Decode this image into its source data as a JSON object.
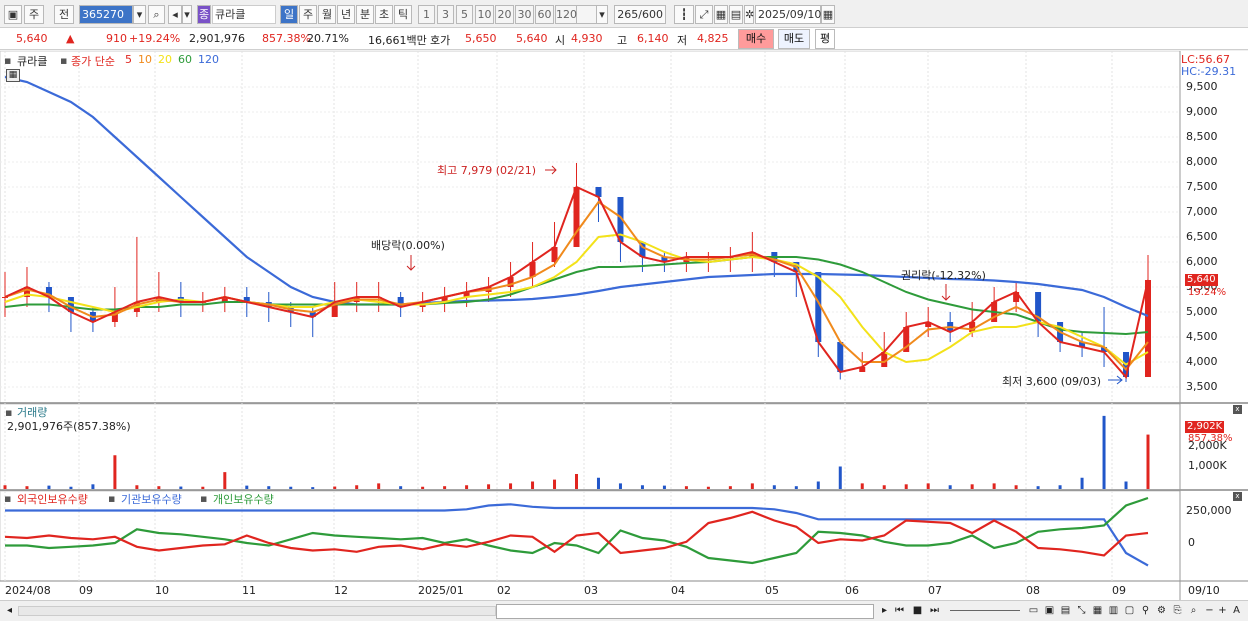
{
  "toolbar": {
    "market": "주",
    "prev_label": "전",
    "code": "365270",
    "name_badge": "종",
    "name": "큐라클",
    "periods": [
      "일",
      "주",
      "월",
      "년",
      "분",
      "초",
      "틱"
    ],
    "active_period": "일",
    "intervals": [
      "1",
      "3",
      "5",
      "10",
      "20",
      "30",
      "60",
      "120"
    ],
    "count": "265",
    "count_total": "/600",
    "date": "2025/09/10"
  },
  "quote": {
    "price": "5,640",
    "direction": "▲",
    "change": "910",
    "change_pct": "+19.24%",
    "volume": "2,901,976",
    "volume_ratio": "857.38%",
    "turnover": "20.71%",
    "amount": "16,661백만",
    "bid_label": "호가",
    "bid1": "5,650",
    "bid2": "5,640",
    "open_label": "시",
    "open": "4,930",
    "high_label": "고",
    "high": "6,140",
    "low_label": "저",
    "low": "4,825",
    "buy_label": "매수",
    "sell_label": "매도",
    "eval_label": "평"
  },
  "price_pane": {
    "name": "큐라클",
    "ma_type": "종가 단순",
    "ma_periods": [
      {
        "p": "5",
        "color": "#e0251f"
      },
      {
        "p": "10",
        "color": "#f08a1c"
      },
      {
        "p": "20",
        "color": "#f3e21a"
      },
      {
        "p": "60",
        "color": "#2e9b3a"
      },
      {
        "p": "120",
        "color": "#3b6ad8"
      }
    ],
    "lc": "LC:56.67",
    "hc": "HC:-29.31",
    "y_ticks": [
      "9,500",
      "9,000",
      "8,500",
      "8,000",
      "7,500",
      "7,000",
      "6,500",
      "6,000",
      "5,500",
      "5,000",
      "4,500",
      "4,000",
      "3,500"
    ],
    "last_price_tag": "5,640",
    "last_pct_tag": "19.24%",
    "ann_high": "최고 7,979 (02/21)",
    "ann_div": "배당락(0.00%)",
    "ann_rights": "권리락(-12.32%)",
    "ann_low": "최저 3,600 (09/03)",
    "series": {
      "price_range": [
        3500,
        9800
      ],
      "ma120": [
        9700,
        9600,
        9400,
        9200,
        8900,
        8500,
        8100,
        7700,
        7300,
        6900,
        6500,
        6100,
        5800,
        5500,
        5300,
        5200,
        5150,
        5150,
        5150,
        5180,
        5200,
        5220,
        5230,
        5240,
        5260,
        5300,
        5350,
        5420,
        5500,
        5550,
        5600,
        5650,
        5700,
        5720,
        5740,
        5760,
        5760,
        5760,
        5750,
        5740,
        5720,
        5700,
        5680,
        5660,
        5650,
        5630,
        5600,
        5560,
        5500,
        5440,
        5300,
        5100,
        4920
      ],
      "ma60": [
        5100,
        5150,
        5150,
        5100,
        5050,
        5050,
        5100,
        5100,
        5150,
        5150,
        5200,
        5200,
        5150,
        5150,
        5150,
        5150,
        5150,
        5150,
        5150,
        5150,
        5180,
        5200,
        5250,
        5350,
        5500,
        5650,
        5800,
        5900,
        5900,
        5920,
        5950,
        5980,
        6000,
        6050,
        6100,
        6100,
        6100,
        6050,
        5950,
        5800,
        5600,
        5400,
        5250,
        5150,
        5050,
        5000,
        4950,
        4800,
        4650,
        4600,
        4580,
        4560,
        4600
      ],
      "ma20": [
        5200,
        5350,
        5300,
        5200,
        5100,
        5000,
        5100,
        5200,
        5250,
        5200,
        5300,
        5200,
        5150,
        5100,
        5100,
        5200,
        5250,
        5200,
        5150,
        5150,
        5200,
        5300,
        5350,
        5400,
        5500,
        5700,
        6000,
        6500,
        6550,
        6400,
        6200,
        6050,
        6000,
        6050,
        6100,
        6050,
        5950,
        5700,
        5300,
        4700,
        4200,
        4000,
        4050,
        4300,
        4600,
        4700,
        4700,
        4800,
        4700,
        4500,
        4300,
        3950,
        4200
      ],
      "ma10": [
        5300,
        5450,
        5350,
        5100,
        4900,
        4950,
        5150,
        5250,
        5200,
        5200,
        5300,
        5200,
        5150,
        5050,
        5000,
        5150,
        5250,
        5250,
        5150,
        5200,
        5300,
        5400,
        5450,
        5550,
        5700,
        5950,
        6600,
        7200,
        6900,
        6300,
        6100,
        6050,
        6050,
        6100,
        6150,
        6050,
        5900,
        5200,
        4400,
        4000,
        4000,
        4300,
        4650,
        4700,
        4650,
        4900,
        5100,
        4900,
        4600,
        4400,
        4300,
        3850,
        4400
      ],
      "close": [
        5300,
        5500,
        5300,
        5000,
        4800,
        5000,
        5200,
        5300,
        5200,
        5200,
        5300,
        5200,
        5100,
        5000,
        4900,
        5200,
        5300,
        5300,
        5100,
        5200,
        5300,
        5400,
        5500,
        5700,
        6000,
        6300,
        7500,
        7300,
        6400,
        6100,
        6000,
        6100,
        6100,
        6100,
        6200,
        6000,
        5800,
        4400,
        3800,
        3900,
        4200,
        4700,
        4800,
        4600,
        4800,
        5200,
        5400,
        4800,
        4400,
        4300,
        4200,
        3700,
        5640
      ],
      "highs": [
        5800,
        5900,
        5600,
        5200,
        5100,
        5500,
        6500,
        5800,
        5600,
        5400,
        5500,
        5500,
        5400,
        5200,
        5100,
        5600,
        5600,
        5600,
        5400,
        5400,
        5500,
        5600,
        5700,
        6000,
        6400,
        6800,
        7979,
        7500,
        6700,
        6300,
        6200,
        6200,
        6200,
        6300,
        6600,
        6200,
        6000,
        4800,
        4100,
        4200,
        4600,
        5000,
        5100,
        5000,
        5200,
        5500,
        5600,
        5300,
        4700,
        4600,
        5100,
        3900,
        6140
      ],
      "lows": [
        4900,
        5100,
        5000,
        4600,
        4600,
        4700,
        4900,
        5000,
        4900,
        5000,
        5000,
        4900,
        4800,
        4700,
        4500,
        4900,
        5000,
        5000,
        4900,
        5000,
        5000,
        5100,
        5200,
        5300,
        5500,
        5900,
        6300,
        6800,
        6000,
        5800,
        5800,
        5800,
        5800,
        5800,
        5800,
        5700,
        5300,
        4100,
        3650,
        3800,
        3900,
        4400,
        4500,
        4400,
        4500,
        4800,
        5000,
        4500,
        4200,
        4100,
        3900,
        3600,
        4825
      ]
    }
  },
  "volume_pane": {
    "title": "거래량",
    "value": "2,901,976주(857.38%)",
    "y_ticks": [
      "2,000K",
      "1,000K"
    ],
    "last_tag": "2,902K",
    "last_pct": "857.38%",
    "volumes_k": [
      200,
      150,
      180,
      120,
      250,
      1800,
      200,
      150,
      130,
      120,
      900,
      180,
      150,
      120,
      100,
      130,
      200,
      300,
      150,
      120,
      150,
      200,
      250,
      300,
      400,
      500,
      800,
      600,
      300,
      200,
      180,
      150,
      120,
      150,
      300,
      200,
      150,
      400,
      1200,
      300,
      200,
      250,
      300,
      200,
      250,
      300,
      200,
      150,
      200,
      600,
      3900,
      400,
      2902
    ],
    "ymax": 4000
  },
  "holdings_pane": {
    "legend": [
      "외국인보유수량",
      "기관보유수량",
      "개인보유수량"
    ],
    "y_ticks": [
      "250,000",
      "0"
    ],
    "foreign": [
      50,
      40,
      60,
      40,
      30,
      50,
      -30,
      -60,
      -40,
      -20,
      -10,
      60,
      0,
      -40,
      -60,
      -50,
      -70,
      -30,
      -20,
      -50,
      -10,
      -30,
      10,
      60,
      50,
      -70,
      60,
      80,
      -80,
      -60,
      -40,
      10,
      160,
      200,
      250,
      180,
      130,
      0,
      30,
      20,
      60,
      180,
      170,
      160,
      80,
      180,
      90,
      -40,
      -50,
      -70,
      -100,
      60,
      80
    ],
    "institution": [
      260,
      260,
      260,
      260,
      260,
      260,
      260,
      260,
      260,
      260,
      260,
      260,
      260,
      260,
      260,
      260,
      260,
      260,
      260,
      260,
      260,
      270,
      300,
      310,
      290,
      280,
      280,
      280,
      280,
      280,
      280,
      280,
      280,
      280,
      280,
      270,
      240,
      190,
      190,
      190,
      190,
      190,
      190,
      190,
      190,
      190,
      190,
      190,
      190,
      190,
      190,
      -80,
      -180
    ],
    "individual": [
      -20,
      -20,
      -40,
      -30,
      -20,
      0,
      110,
      80,
      70,
      50,
      30,
      0,
      -20,
      30,
      80,
      60,
      50,
      40,
      30,
      40,
      0,
      30,
      -20,
      -60,
      -80,
      0,
      -20,
      -80,
      100,
      40,
      20,
      -30,
      -120,
      -140,
      -160,
      -120,
      -80,
      90,
      80,
      60,
      10,
      -20,
      -20,
      0,
      60,
      -40,
      0,
      90,
      110,
      120,
      140,
      300,
      360
    ]
  },
  "x_axis": [
    "2024/08",
    "09",
    "10",
    "11",
    "12",
    "2025/01",
    "02",
    "03",
    "04",
    "05",
    "06",
    "07",
    "08",
    "09"
  ],
  "x_axis_right": "09/10"
}
